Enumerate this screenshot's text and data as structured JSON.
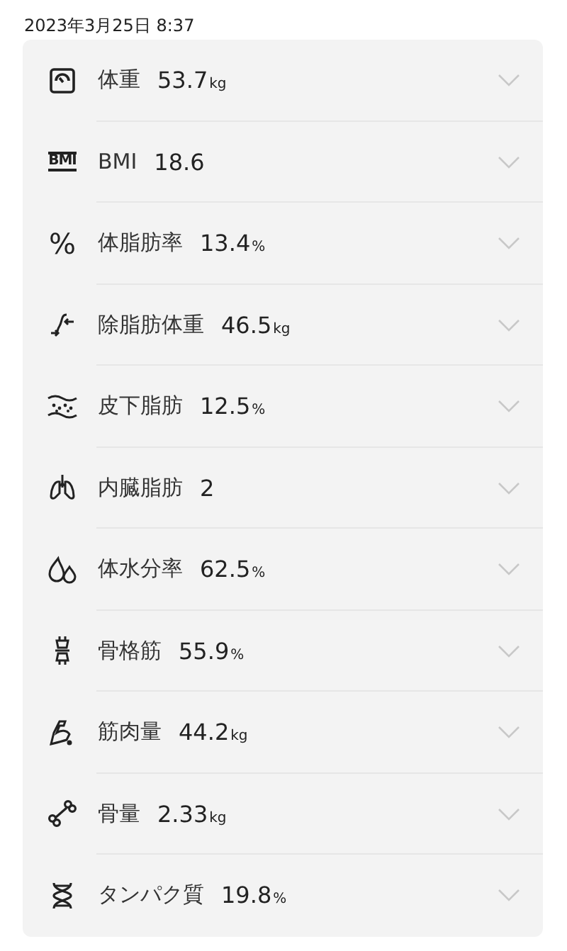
{
  "timestamp": "2023年3月25日 8:37",
  "items": [
    {
      "kind": "scale",
      "label": "体重",
      "value": "53.7",
      "unit": "kg",
      "expanded": false
    },
    {
      "kind": "bmi",
      "icon_label": "BMI",
      "label": "BMI",
      "value": "18.6",
      "expanded": false
    },
    {
      "kind": "percent",
      "icon_label": "%",
      "label": "体脂肪率",
      "value": "13.4",
      "unit": "%",
      "expanded": false
    },
    {
      "kind": "arrows",
      "label": "除脂肪体重",
      "value": "46.5",
      "unit": "kg",
      "expanded": false
    },
    {
      "kind": "fat",
      "label": "皮下脂肪",
      "value": "12.5",
      "unit": "%",
      "expanded": false
    },
    {
      "kind": "lungs",
      "label": "内臓脂肪",
      "value": "2",
      "expanded": false
    },
    {
      "kind": "drops",
      "label": "体水分率",
      "value": "62.5",
      "unit": "%",
      "expanded": false
    },
    {
      "kind": "joint",
      "label": "骨格筋",
      "value": "55.9",
      "unit": "%",
      "expanded": false
    },
    {
      "kind": "muscle",
      "label": "筋肉量",
      "value": "44.2",
      "unit": "kg",
      "expanded": false
    },
    {
      "kind": "bone",
      "label": "骨量",
      "value": "2.33",
      "unit": "kg",
      "expanded": false
    },
    {
      "kind": "dna",
      "label": "タンパク質",
      "value": "19.8",
      "unit": "%",
      "expanded": false
    }
  ]
}
